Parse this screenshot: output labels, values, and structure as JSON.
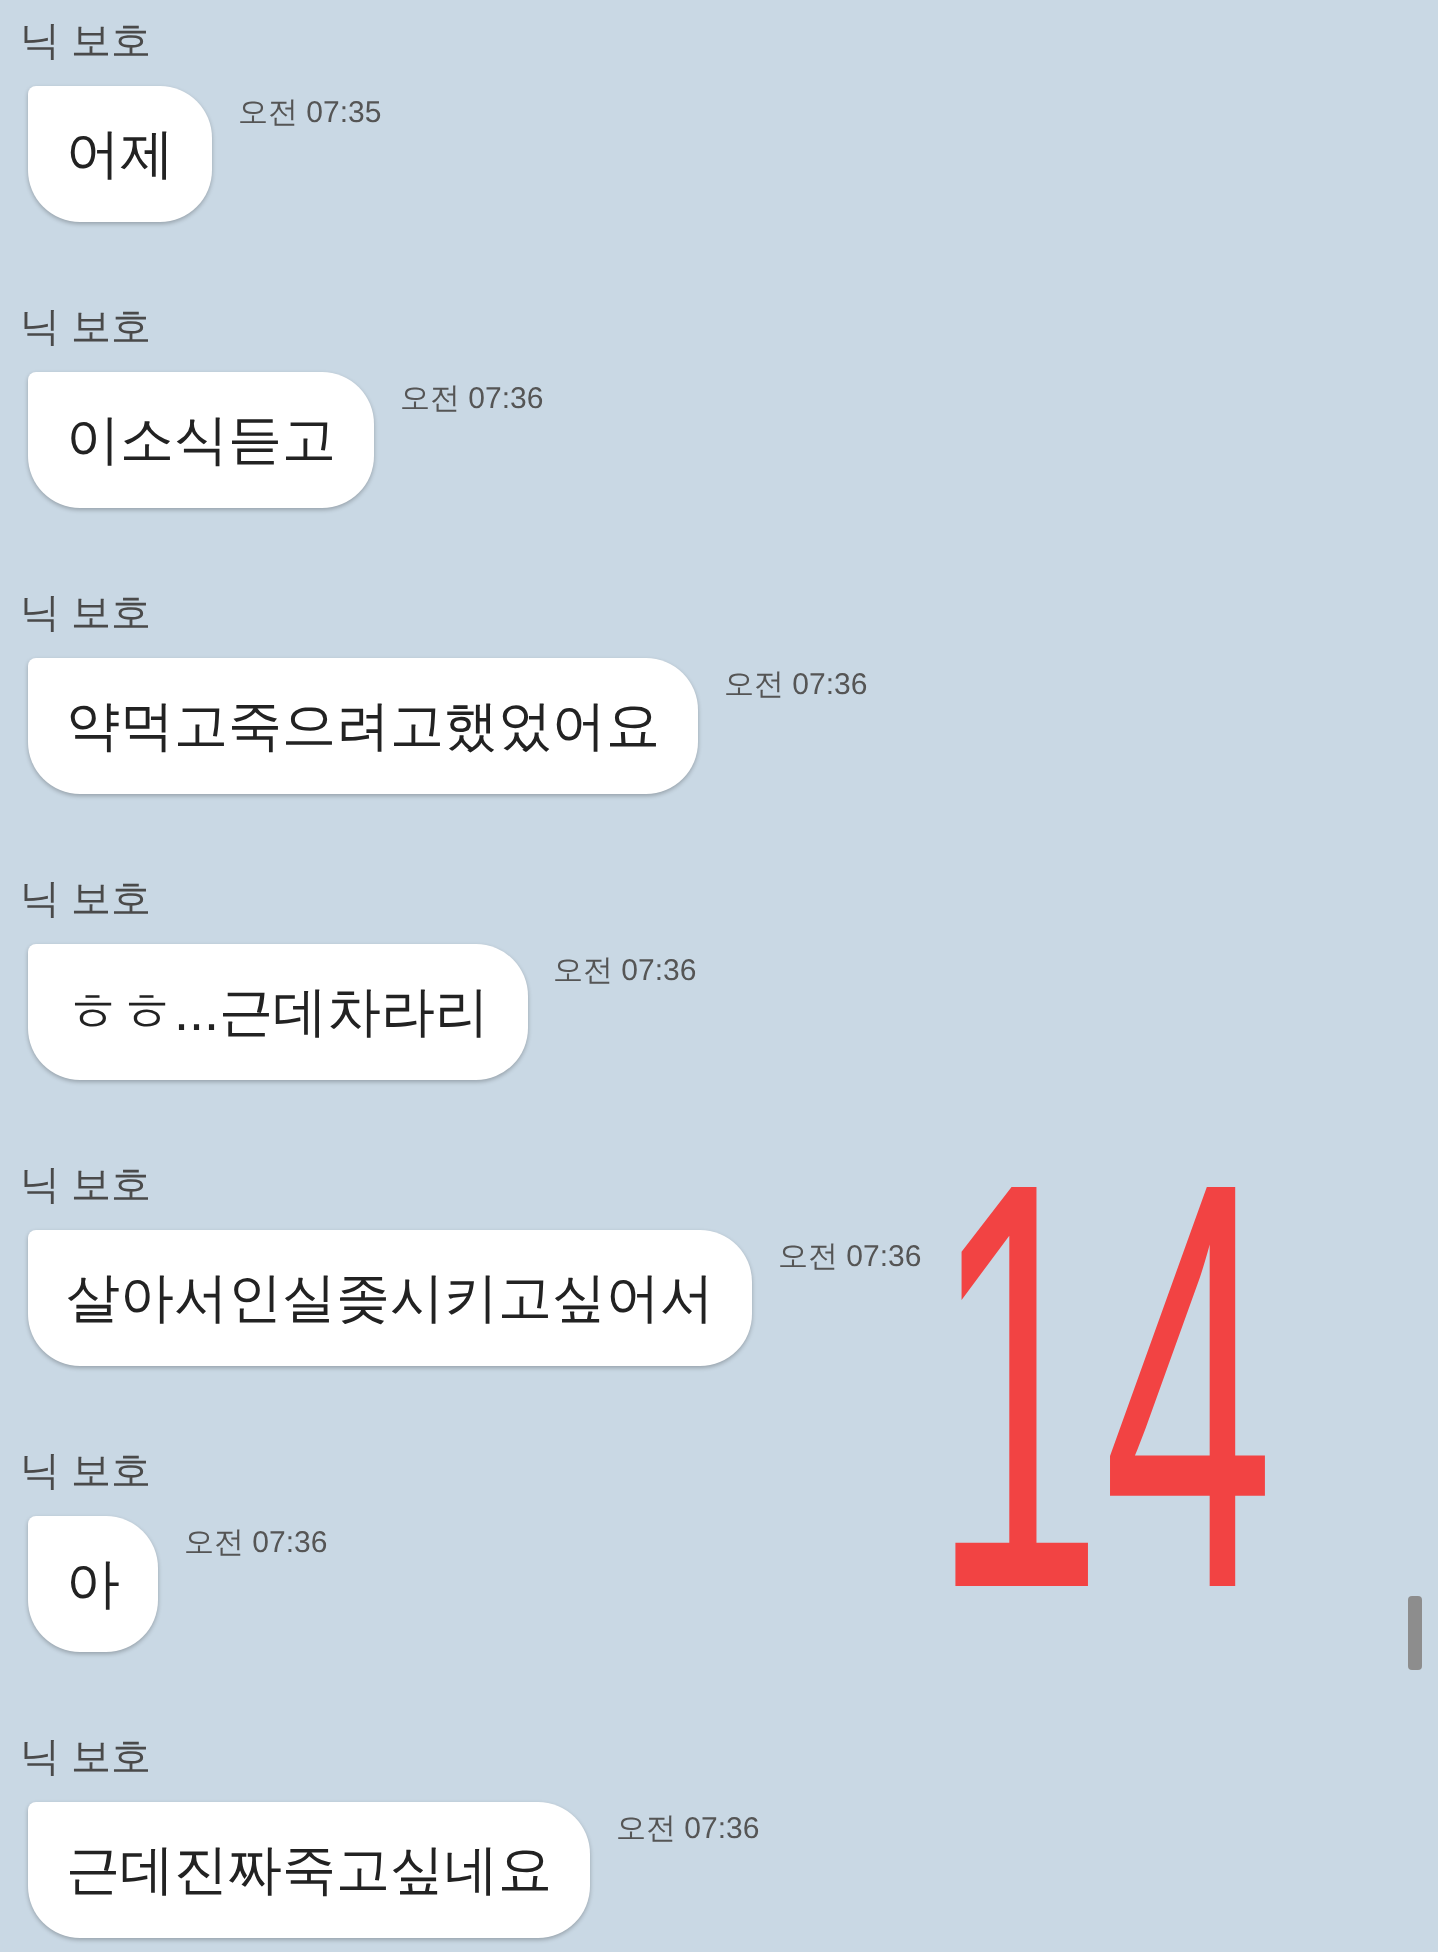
{
  "messages": [
    {
      "sender": "닉 보호",
      "text": "어제",
      "time": "오전 07:35"
    },
    {
      "sender": "닉 보호",
      "text": "이소식듣고",
      "time": "오전 07:36"
    },
    {
      "sender": "닉 보호",
      "text": "약먹고죽으려고했었어요",
      "time": "오전 07:36"
    },
    {
      "sender": "닉 보호",
      "text": "ㅎㅎ...근데차라리",
      "time": "오전 07:36"
    },
    {
      "sender": "닉 보호",
      "text": "살아서인실좆시키고싶어서",
      "time": "오전 07:36"
    },
    {
      "sender": "닉 보호",
      "text": "아",
      "time": "오전 07:36"
    },
    {
      "sender": "닉 보호",
      "text": "근데진짜죽고싶네요",
      "time": "오전 07:36"
    }
  ],
  "handwritten_mark": "14"
}
